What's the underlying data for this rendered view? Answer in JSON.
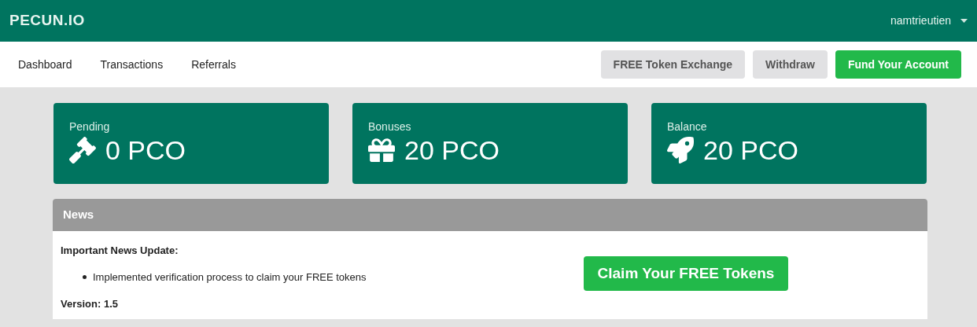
{
  "brand": "PECUN.IO",
  "user": "namtrieutien",
  "nav": [
    {
      "label": "Dashboard"
    },
    {
      "label": "Transactions"
    },
    {
      "label": "Referrals"
    }
  ],
  "actions": [
    {
      "label": "FREE Token Exchange",
      "kind": "secondary"
    },
    {
      "label": "Withdraw",
      "kind": "secondary"
    },
    {
      "label": "Fund Your Account",
      "kind": "primary"
    }
  ],
  "stats": [
    {
      "label": "Pending",
      "value": "0 PCO",
      "kind": "pending"
    },
    {
      "label": "Bonuses",
      "value": "20 PCO",
      "kind": "bonus"
    },
    {
      "label": "Balance",
      "value": "20 PCO",
      "kind": "balance"
    }
  ],
  "news": {
    "title": "News",
    "heading": "Important News Update:",
    "items": [
      "Implemented verification process to claim your FREE tokens"
    ],
    "version": "Version: 1.5",
    "cta": "Claim Your FREE Tokens"
  }
}
